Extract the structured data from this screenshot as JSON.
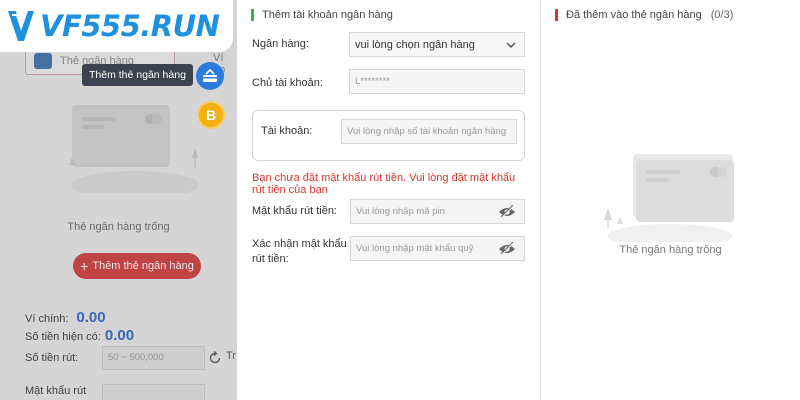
{
  "brand": {
    "logo_text": "VF555.RUN",
    "accent": "#1f8fe0"
  },
  "left": {
    "bank_pill_label": "Thẻ ngân hàng",
    "vi_label": "Ví ảo",
    "tooltip": "Thêm thẻ ngân hàng",
    "coin_glyph": "B",
    "empty_text": "Thẻ ngân hàng trống",
    "add_button": "Thêm thẻ ngân hàng",
    "main_wallet_label": "Ví chính:",
    "main_wallet_value": "0.00",
    "current_amount_label": "Số tiền hiện có:",
    "current_amount_value": "0.00",
    "withdraw_label": "Số tiền rút:",
    "withdraw_placeholder": "50 ~ 500,000",
    "refresh_label": "Tr",
    "password_label": "Mật khẩu rút"
  },
  "form": {
    "title": "Thêm tài khoản ngân hàng",
    "bank_label": "Ngân hàng:",
    "bank_select_value": "vui lòng chọn ngân hàng",
    "owner_label": "Chủ tài khoản:",
    "owner_value": "L********",
    "account_label": "Tài khoản:",
    "account_placeholder": "Vui lòng nhập số tài khoản ngân hàng",
    "warning": "Bạn chưa đặt mật khẩu rút tiền. Vui lòng đặt mật khẩu rút tiền của bạn",
    "pin_label": "Mật khẩu rút tiền:",
    "pin_placeholder": "Vui lòng nhập mã pin",
    "confirm_label": "Xác nhận mật khẩu rút tiền:",
    "confirm_placeholder": "Vui lòng nhập mật khẩu quỹ"
  },
  "right": {
    "title": "Đã thêm vào thẻ ngân hàng",
    "count": "(0/3)",
    "empty_text": "Thẻ ngân hàng trống"
  },
  "colors": {
    "danger": "#d9352f",
    "success": "#36b24a",
    "primary_button": "#d0393a"
  }
}
